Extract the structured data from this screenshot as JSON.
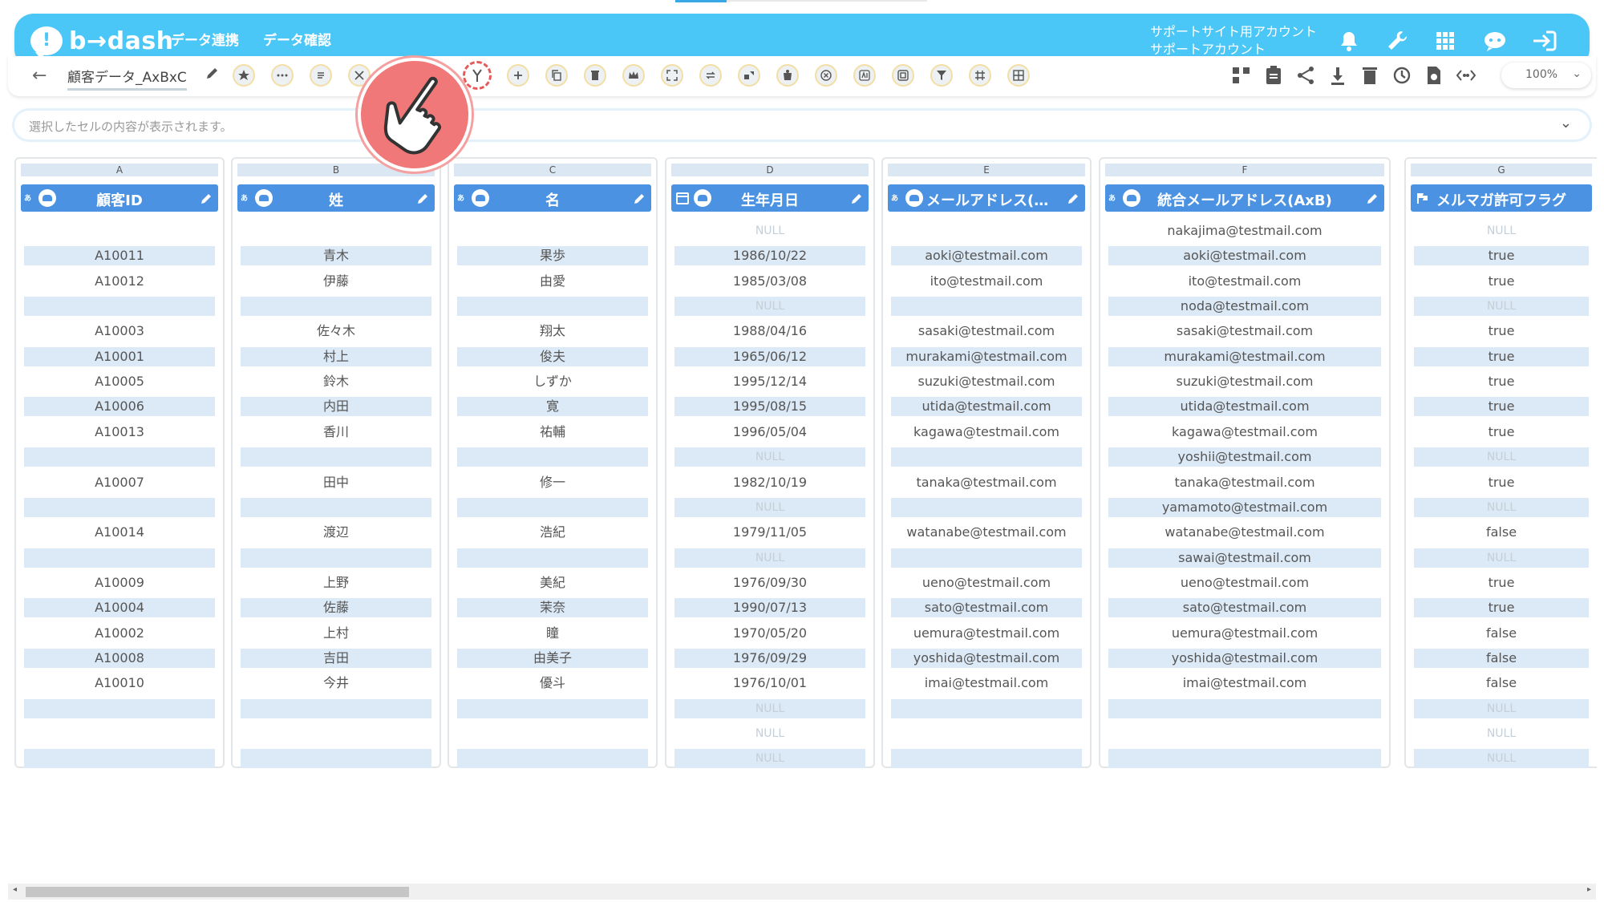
{
  "app": {
    "logo_mark": "!",
    "logo_text": "b→dash",
    "nav": [
      "データ連携",
      "データ確認"
    ],
    "account_line1": "サポートサイト用アカウント",
    "account_line2": "サポートアカウント",
    "brand_color": "#4ac6f7"
  },
  "toolbar": {
    "back_icon": "←",
    "table_name": "顧客データ_AxBxC",
    "zoom": "100%",
    "zoom_chevron": "⌄"
  },
  "formula_bar": {
    "placeholder": "選択したセルの内容が表示されます。",
    "chevron": "⌄"
  },
  "grid": {
    "letters": [
      "A",
      "B",
      "C",
      "D",
      "E",
      "F",
      "G"
    ],
    "headers": [
      {
        "title": "顧客ID",
        "type": "あ"
      },
      {
        "title": "姓",
        "type": "あ"
      },
      {
        "title": "名",
        "type": "あ"
      },
      {
        "title": "生年月日",
        "type": "date"
      },
      {
        "title": "メールアドレス(…",
        "type": "あ"
      },
      {
        "title": "統合メールアドレス(AxB)",
        "type": "あ"
      },
      {
        "title": "メルマガ許可フラグ",
        "type": "flag"
      }
    ],
    "rows": [
      [
        "",
        "",
        "",
        "NULL",
        "",
        "nakajima@testmail.com",
        "NULL"
      ],
      [
        "A10011",
        "青木",
        "果歩",
        "1986/10/22",
        "aoki@testmail.com",
        "aoki@testmail.com",
        "true"
      ],
      [
        "A10012",
        "伊藤",
        "由愛",
        "1985/03/08",
        "ito@testmail.com",
        "ito@testmail.com",
        "true"
      ],
      [
        "",
        "",
        "",
        "NULL",
        "",
        "noda@testmail.com",
        "NULL"
      ],
      [
        "A10003",
        "佐々木",
        "翔太",
        "1988/04/16",
        "sasaki@testmail.com",
        "sasaki@testmail.com",
        "true"
      ],
      [
        "A10001",
        "村上",
        "俊夫",
        "1965/06/12",
        "murakami@testmail.com",
        "murakami@testmail.com",
        "true"
      ],
      [
        "A10005",
        "鈴木",
        "しずか",
        "1995/12/14",
        "suzuki@testmail.com",
        "suzuki@testmail.com",
        "true"
      ],
      [
        "A10006",
        "内田",
        "寛",
        "1995/08/15",
        "utida@testmail.com",
        "utida@testmail.com",
        "true"
      ],
      [
        "A10013",
        "香川",
        "祐輔",
        "1996/05/04",
        "kagawa@testmail.com",
        "kagawa@testmail.com",
        "true"
      ],
      [
        "",
        "",
        "",
        "NULL",
        "",
        "yoshii@testmail.com",
        "NULL"
      ],
      [
        "A10007",
        "田中",
        "修一",
        "1982/10/19",
        "tanaka@testmail.com",
        "tanaka@testmail.com",
        "true"
      ],
      [
        "",
        "",
        "",
        "NULL",
        "",
        "yamamoto@testmail.com",
        "NULL"
      ],
      [
        "A10014",
        "渡辺",
        "浩紀",
        "1979/11/05",
        "watanabe@testmail.com",
        "watanabe@testmail.com",
        "false"
      ],
      [
        "",
        "",
        "",
        "NULL",
        "",
        "sawai@testmail.com",
        "NULL"
      ],
      [
        "A10009",
        "上野",
        "美紀",
        "1976/09/30",
        "ueno@testmail.com",
        "ueno@testmail.com",
        "true"
      ],
      [
        "A10004",
        "佐藤",
        "茉奈",
        "1990/07/13",
        "sato@testmail.com",
        "sato@testmail.com",
        "true"
      ],
      [
        "A10002",
        "上村",
        "瞳",
        "1970/05/20",
        "uemura@testmail.com",
        "uemura@testmail.com",
        "false"
      ],
      [
        "A10008",
        "吉田",
        "由美子",
        "1976/09/29",
        "yoshida@testmail.com",
        "yoshida@testmail.com",
        "false"
      ],
      [
        "A10010",
        "今井",
        "優斗",
        "1976/10/01",
        "imai@testmail.com",
        "imai@testmail.com",
        "false"
      ],
      [
        "",
        "",
        "",
        "NULL",
        "",
        "",
        "NULL"
      ],
      [
        "",
        "",
        "",
        "NULL",
        "",
        "",
        "NULL"
      ],
      [
        "",
        "",
        "",
        "NULL",
        "",
        "",
        "NULL"
      ]
    ]
  },
  "scrollbar": {
    "left_arrow": "◂",
    "right_arrow": "▸"
  }
}
